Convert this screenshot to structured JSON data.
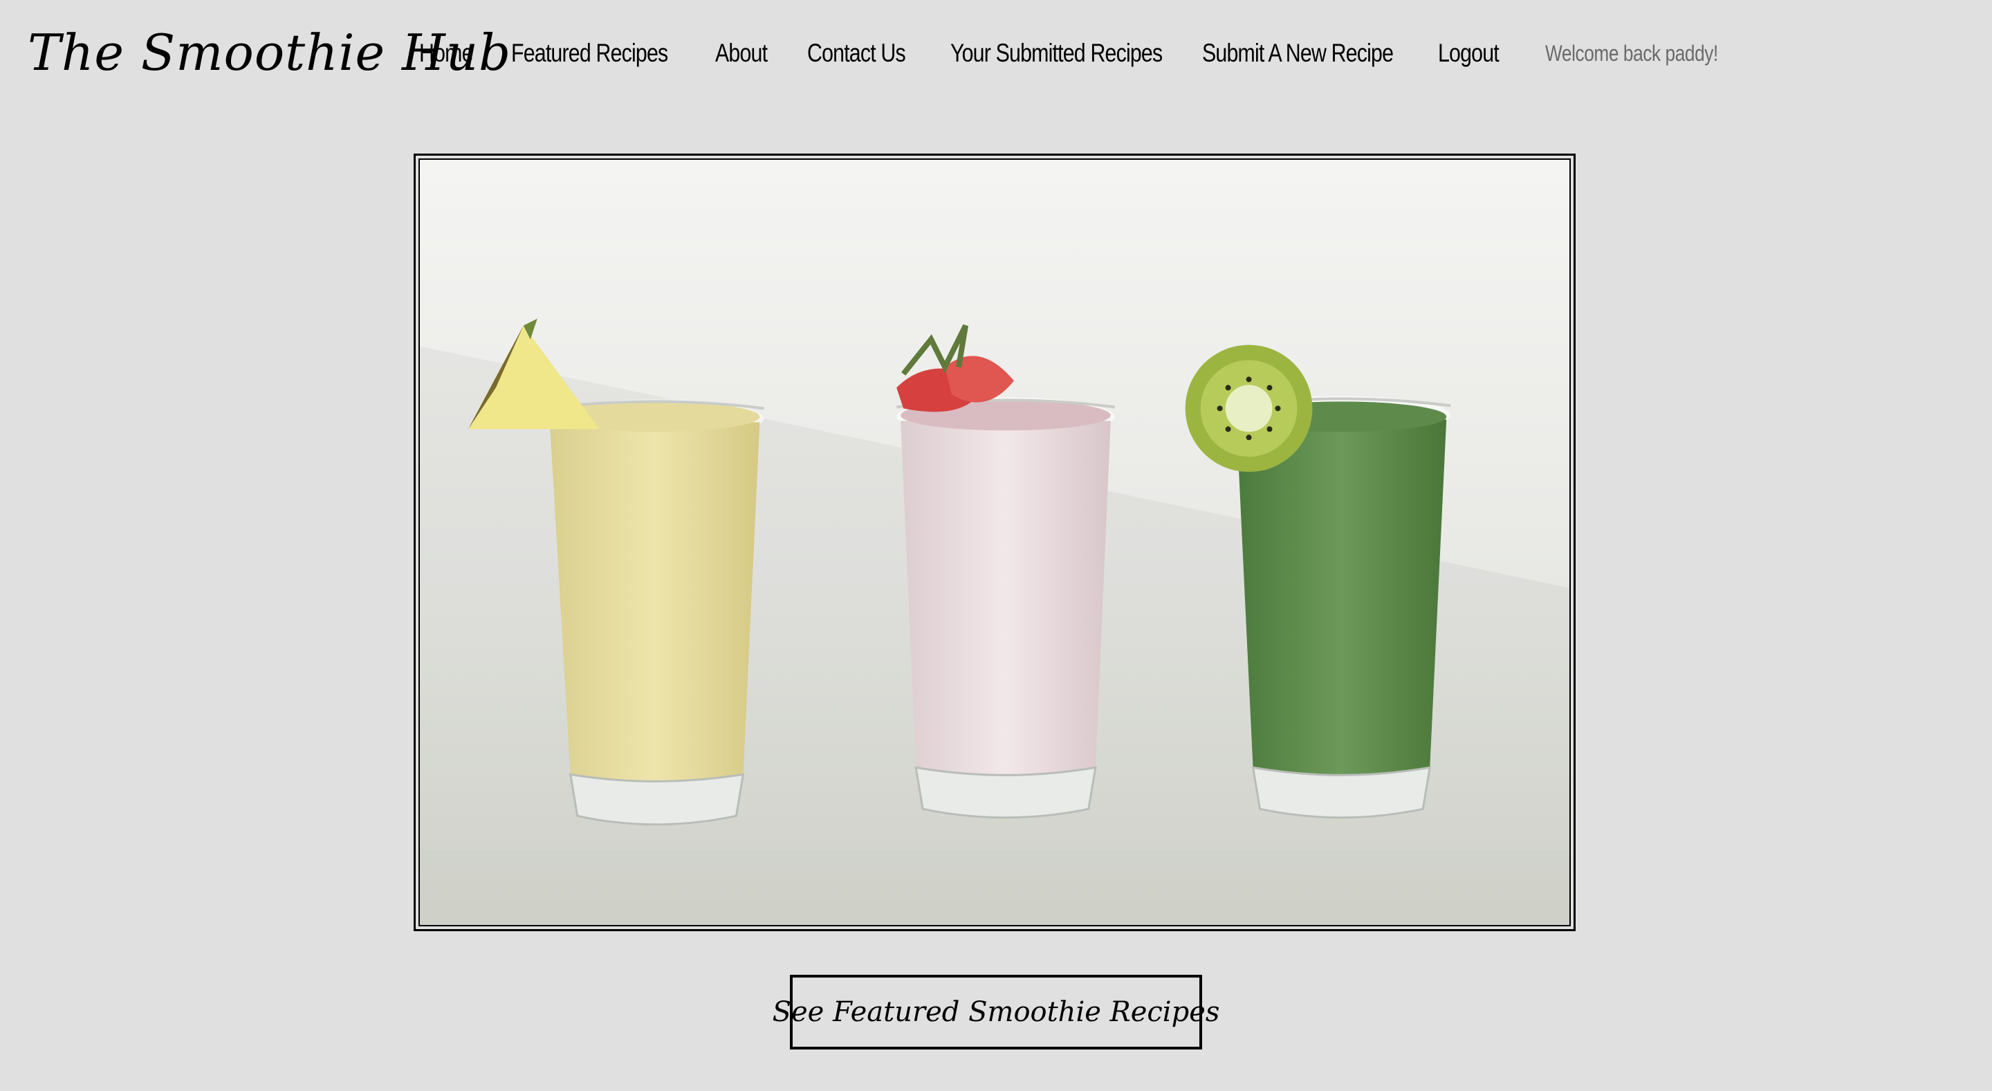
{
  "brand": {
    "logo_text": "The Smoothie Hub"
  },
  "nav": {
    "items": [
      {
        "label": "Home"
      },
      {
        "label": "Featured Recipes"
      },
      {
        "label": "About"
      },
      {
        "label": "Contact Us"
      },
      {
        "label": "Your Submitted Recipes"
      },
      {
        "label": "Submit A New Recipe"
      },
      {
        "label": "Logout"
      }
    ],
    "welcome_text": "Welcome back paddy!"
  },
  "hero": {
    "image_subject": "three-smoothies-photo",
    "smoothies": [
      {
        "color": "#e6dc9c",
        "garnish": "pineapple"
      },
      {
        "color": "#eadde0",
        "garnish": "strawberry"
      },
      {
        "color": "#5f8c4e",
        "garnish": "kiwi"
      }
    ]
  },
  "cta": {
    "label": "See Featured Smoothie Recipes"
  },
  "colors": {
    "background": "#e0e0e0",
    "text": "#000000",
    "muted_text": "#6a6a6a"
  }
}
